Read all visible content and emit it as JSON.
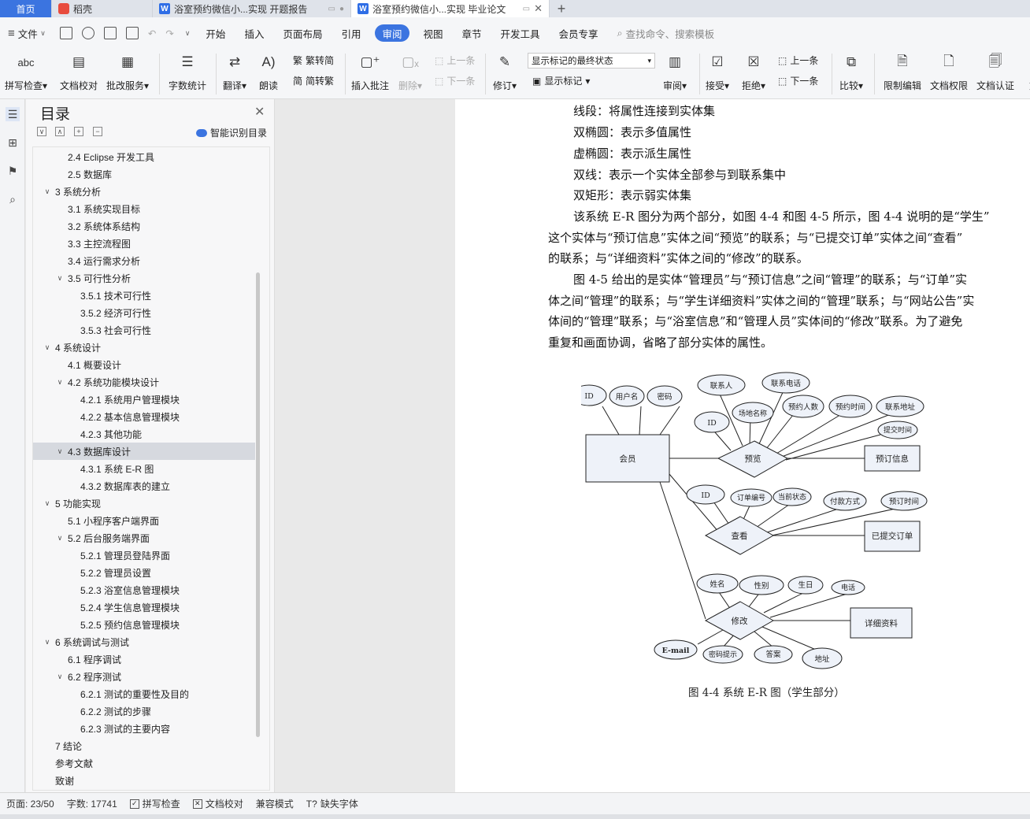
{
  "tabs": {
    "home": "首页",
    "daoke": "稻壳",
    "doc1": "浴室预约微信小...实现 开题报告",
    "doc2": "浴室预约微信小...实现 毕业论文",
    "new_tab": "+"
  },
  "menu": {
    "file": "文件",
    "items": [
      "开始",
      "插入",
      "页面布局",
      "引用",
      "审阅",
      "视图",
      "章节",
      "开发工具",
      "会员专享"
    ],
    "active": "审阅",
    "search_placeholder": "查找命令、搜索模板"
  },
  "ribbon": {
    "spellcheck": "拼写检查",
    "doc_proof": "文档校对",
    "batch_service": "批改服务",
    "word_count": "字数统计",
    "translate": "翻译",
    "read_aloud": "朗读",
    "trad_simp": "繁转简",
    "simp_trad": "简转繁",
    "insert_comment": "插入批注",
    "delete": "删除",
    "prev_comment": "上一条",
    "next_comment": "下一条",
    "track_changes": "修订",
    "markup_mode": "显示标记的最终状态",
    "show_markup": "显示标记",
    "review": "审阅",
    "accept": "接受",
    "reject": "拒绝",
    "prev_change": "上一条",
    "next_change": "下一条",
    "compare": "比较",
    "restrict_edit": "限制编辑",
    "doc_permission": "文档权限",
    "doc_cert": "文档认证",
    "more": "文"
  },
  "toc": {
    "title": "目录",
    "smart_detect": "智能识别目录",
    "items": [
      {
        "text": "2.4 Eclipse 开发工具",
        "level": 2,
        "toggle": ""
      },
      {
        "text": "2.5 数据库",
        "level": 2,
        "toggle": ""
      },
      {
        "text": "3  系统分析",
        "level": 1,
        "toggle": "v"
      },
      {
        "text": "3.1  系统实现目标",
        "level": 2,
        "toggle": ""
      },
      {
        "text": "3.2  系统体系结构",
        "level": 2,
        "toggle": ""
      },
      {
        "text": "3.3  主控流程图",
        "level": 2,
        "toggle": ""
      },
      {
        "text": "3.4  运行需求分析",
        "level": 2,
        "toggle": ""
      },
      {
        "text": "3.5  可行性分析",
        "level": 2,
        "toggle": "v"
      },
      {
        "text": "3.5.1 技术可行性",
        "level": 3,
        "toggle": ""
      },
      {
        "text": "3.5.2 经济可行性",
        "level": 3,
        "toggle": ""
      },
      {
        "text": "3.5.3 社会可行性",
        "level": 3,
        "toggle": ""
      },
      {
        "text": "4  系统设计",
        "level": 1,
        "toggle": "v"
      },
      {
        "text": "4.1  概要设计",
        "level": 2,
        "toggle": ""
      },
      {
        "text": "4.2  系统功能模块设计",
        "level": 2,
        "toggle": "v"
      },
      {
        "text": "4.2.1  系统用户管理模块",
        "level": 3,
        "toggle": ""
      },
      {
        "text": "4.2.2  基本信息管理模块",
        "level": 3,
        "toggle": ""
      },
      {
        "text": "4.2.3  其他功能",
        "level": 3,
        "toggle": ""
      },
      {
        "text": "4.3  数据库设计",
        "level": 2,
        "toggle": "v",
        "selected": true
      },
      {
        "text": "4.3.1  系统 E-R 图",
        "level": 3,
        "toggle": ""
      },
      {
        "text": "4.3.2  数据库表的建立",
        "level": 3,
        "toggle": ""
      },
      {
        "text": "5  功能实现",
        "level": 1,
        "toggle": "v"
      },
      {
        "text": "5.1  小程序客户端界面",
        "level": 2,
        "toggle": ""
      },
      {
        "text": "5.2  后台服务端界面",
        "level": 2,
        "toggle": "v"
      },
      {
        "text": "5.2.1  管理员登陆界面",
        "level": 3,
        "toggle": ""
      },
      {
        "text": "5.2.2  管理员设置",
        "level": 3,
        "toggle": ""
      },
      {
        "text": "5.2.3  浴室信息管理模块",
        "level": 3,
        "toggle": ""
      },
      {
        "text": "5.2.4  学生信息管理模块",
        "level": 3,
        "toggle": ""
      },
      {
        "text": "5.2.5  预约信息管理模块",
        "level": 3,
        "toggle": ""
      },
      {
        "text": "6  系统调试与测试",
        "level": 1,
        "toggle": "v"
      },
      {
        "text": "6.1  程序调试",
        "level": 2,
        "toggle": ""
      },
      {
        "text": "6.2  程序测试",
        "level": 2,
        "toggle": "v"
      },
      {
        "text": "6.2.1  测试的重要性及目的",
        "level": 3,
        "toggle": ""
      },
      {
        "text": "6.2.2  测试的步骤",
        "level": 3,
        "toggle": ""
      },
      {
        "text": "6.2.3  测试的主要内容",
        "level": 3,
        "toggle": ""
      },
      {
        "text": "7  结论",
        "level": 1,
        "toggle": ""
      },
      {
        "text": "参考文献",
        "level": 1,
        "toggle": ""
      },
      {
        "text": "致谢",
        "level": 1,
        "toggle": ""
      }
    ]
  },
  "document": {
    "lines": [
      "线段：将属性连接到实体集",
      "双椭圆：表示多值属性",
      "虚椭圆：表示派生属性",
      "双线：表示一个实体全部参与到联系集中",
      "双矩形：表示弱实体集",
      "该系统 E-R 图分为两个部分，如图 4-4 和图 4-5 所示，图 4-4 说明的是“学生”",
      "这个实体与“预订信息”实体之间“预览”的联系；与“已提交订单”实体之间“查看”",
      "的联系；与“详细资料”实体之间的“修改”的联系。",
      "图 4-5 给出的是实体“管理员”与“预订信息”之间“管理”的联系；与“订单”实",
      "体之间“管理”的联系；与“学生详细资料”实体之间的“管理”联系；与“网站公告”实",
      "体间的“管理”联系；与“浴室信息”和“管理人员”实体间的“修改”联系。为了避免",
      "重复和画面协调，省略了部分实体的属性。"
    ],
    "figure_caption": "图 4-4  系统 E-R 图（学生部分）",
    "er": {
      "member": "会员",
      "member_attrs": [
        "ID",
        "用户名",
        "密码"
      ],
      "preview": "预览",
      "preview_attrs": [
        "联系人",
        "联系电话",
        "ID",
        "场地名称",
        "预约人数",
        "预约时间",
        "联系地址",
        "提交时间"
      ],
      "booking_info": "预订信息",
      "view": "查看",
      "view_attrs": [
        "ID",
        "订单编号",
        "当前状态",
        "付款方式",
        "预订时间"
      ],
      "submitted_orders": "已提交订单",
      "modify": "修改",
      "modify_attrs": [
        "姓名",
        "性别",
        "生日",
        "电话",
        "E-mail",
        "密码提示",
        "答案",
        "地址"
      ],
      "details": "详细资料"
    }
  },
  "status": {
    "page": "页面: 23/50",
    "words": "字数: 17741",
    "spell": "拼写检查",
    "proof": "文档校对",
    "compat": "兼容模式",
    "missing_font": "缺失字体"
  }
}
